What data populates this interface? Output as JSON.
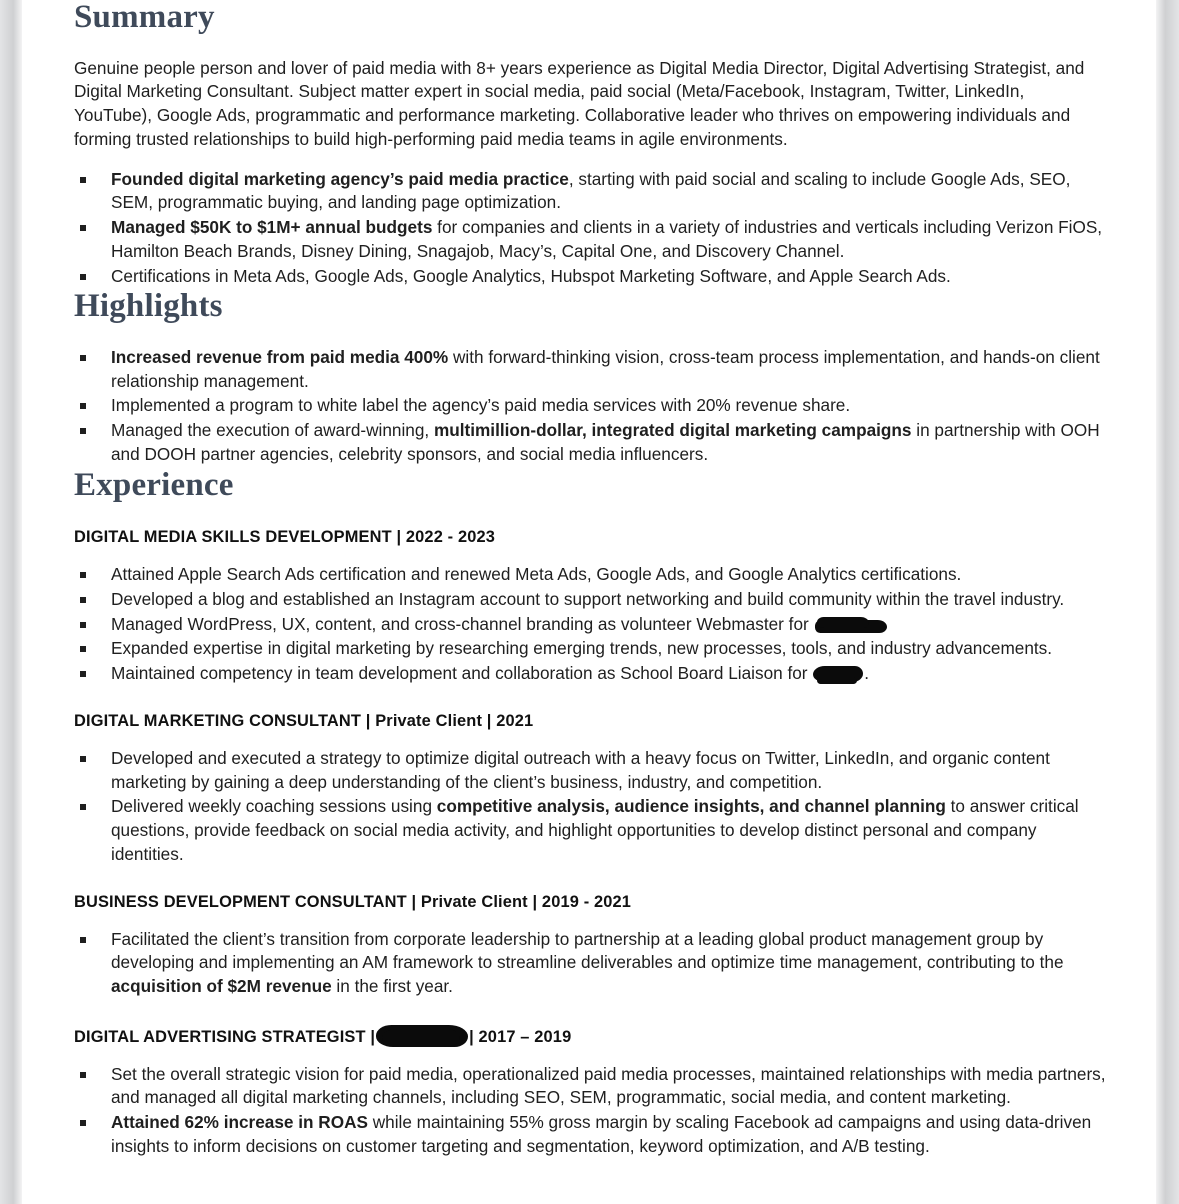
{
  "document": {
    "sections": [
      {
        "id": "summary",
        "heading": "Summary",
        "paragraph": "Genuine people person and lover of paid media with 8+ years experience as Digital Media Director, Digital Advertising Strategist, and Digital Marketing Consultant. Subject matter expert in social media, paid social (Meta/Facebook, Instagram, Twitter, LinkedIn, YouTube), Google Ads, programmatic and performance marketing. Collaborative leader who thrives on empowering individuals and forming trusted relationships to build high-performing paid media teams in agile environments.",
        "bullets": [
          {
            "bold": "Founded digital marketing agency’s paid media practice",
            "rest": ", starting with paid social and scaling to include Google Ads, SEO, SEM, programmatic buying, and landing page optimization."
          },
          {
            "bold": "Managed $50K to $1M+ annual budgets",
            "rest": " for companies and clients in a variety of industries and verticals including Verizon FiOS, Hamilton Beach Brands, Disney Dining, Snagajob, Macy’s, Capital One, and Discovery Channel."
          },
          {
            "bold": "",
            "rest": "Certifications in Meta Ads, Google Ads, Google Analytics, Hubspot Marketing Software, and Apple Search Ads."
          }
        ]
      },
      {
        "id": "highlights",
        "heading": "Highlights",
        "bullets": [
          {
            "bold": "Increased revenue from paid media 400%",
            "rest": " with forward-thinking vision, cross-team process implementation, and hands-on client relationship management."
          },
          {
            "bold": "",
            "rest": "Implemented a program to white label the agency’s paid media services with 20% revenue share."
          },
          {
            "pre": "Managed the execution of award-winning, ",
            "bold": "multimillion-dollar, integrated digital marketing campaigns",
            "rest": " in partnership with OOH and DOOH partner agencies, celebrity sponsors, and social media influencers."
          }
        ]
      },
      {
        "id": "experience",
        "heading": "Experience"
      }
    ],
    "jobs": [
      {
        "id": "digital-media-skills-development",
        "title": "DIGITAL MEDIA SKILLS DEVELOPMENT | 2022 - 2023",
        "title_redacted": false,
        "bullets": [
          {
            "bold": "",
            "rest": "Attained Apple Search Ads certification and renewed Meta Ads, Google Ads, and Google Analytics certifications."
          },
          {
            "bold": "",
            "rest": "Developed a blog and established an Instagram account to support networking and build community within the travel industry."
          },
          {
            "bold": "",
            "rest": "Managed WordPress, UX, content, and cross-channel branding as volunteer Webmaster for ",
            "redaction": "wide",
            "tail": ""
          },
          {
            "bold": "",
            "rest": "Expanded expertise in digital marketing by researching emerging trends, new processes, tools, and industry advancements."
          },
          {
            "bold": "",
            "rest": "Maintained competency in team development and collaboration as School Board Liaison for ",
            "redaction": "small",
            "tail": "."
          }
        ]
      },
      {
        "id": "digital-marketing-consultant",
        "title": "DIGITAL MARKETING CONSULTANT | Private Client | 2021",
        "title_redacted": false,
        "bullets": [
          {
            "bold": "",
            "rest": "Developed and executed a strategy to optimize digital outreach with a heavy focus on Twitter, LinkedIn, and organic content marketing by gaining a deep understanding of the client’s business, industry, and competition."
          },
          {
            "pre": "Delivered weekly coaching sessions using ",
            "bold": "competitive analysis, audience insights, and channel planning",
            "rest": " to answer critical questions, provide feedback on social media activity, and highlight opportunities to develop distinct personal and company identities."
          }
        ]
      },
      {
        "id": "business-development-consultant",
        "title": "BUSINESS DEVELOPMENT CONSULTANT | Private Client | 2019 - 2021",
        "title_redacted": false,
        "bullets": [
          {
            "pre": "Facilitated the client’s transition from corporate leadership to partnership at a leading global product management group by developing and implementing an AM framework to streamline deliverables and optimize time management, contributing to the ",
            "bold": "acquisition of $2M revenue",
            "rest": " in the first year."
          }
        ]
      },
      {
        "id": "digital-advertising-strategist",
        "title_prefix": "DIGITAL ADVERTISING STRATEGIST |",
        "title_suffix": "| 2017 – 2019",
        "title_redacted": true,
        "bullets": [
          {
            "bold": "",
            "rest": "Set the overall strategic vision for paid media, operationalized paid media processes, maintained relationships with media partners, and managed all digital marketing channels, including SEO, SEM, programmatic, social media, and content marketing."
          },
          {
            "bold": "Attained 62% increase in ROAS",
            "rest": " while maintaining 55% gross margin by scaling Facebook ad campaigns and using data-driven insights to inform decisions on customer targeting and segmentation, keyword optimization, and A/B testing."
          }
        ]
      }
    ],
    "colors": {
      "heading": "#3f4a5a",
      "body_text": "#1f1f1f",
      "page_background": "#ffffff",
      "viewer_background": "#d7d8da",
      "redaction": "#0b0b0b"
    }
  }
}
